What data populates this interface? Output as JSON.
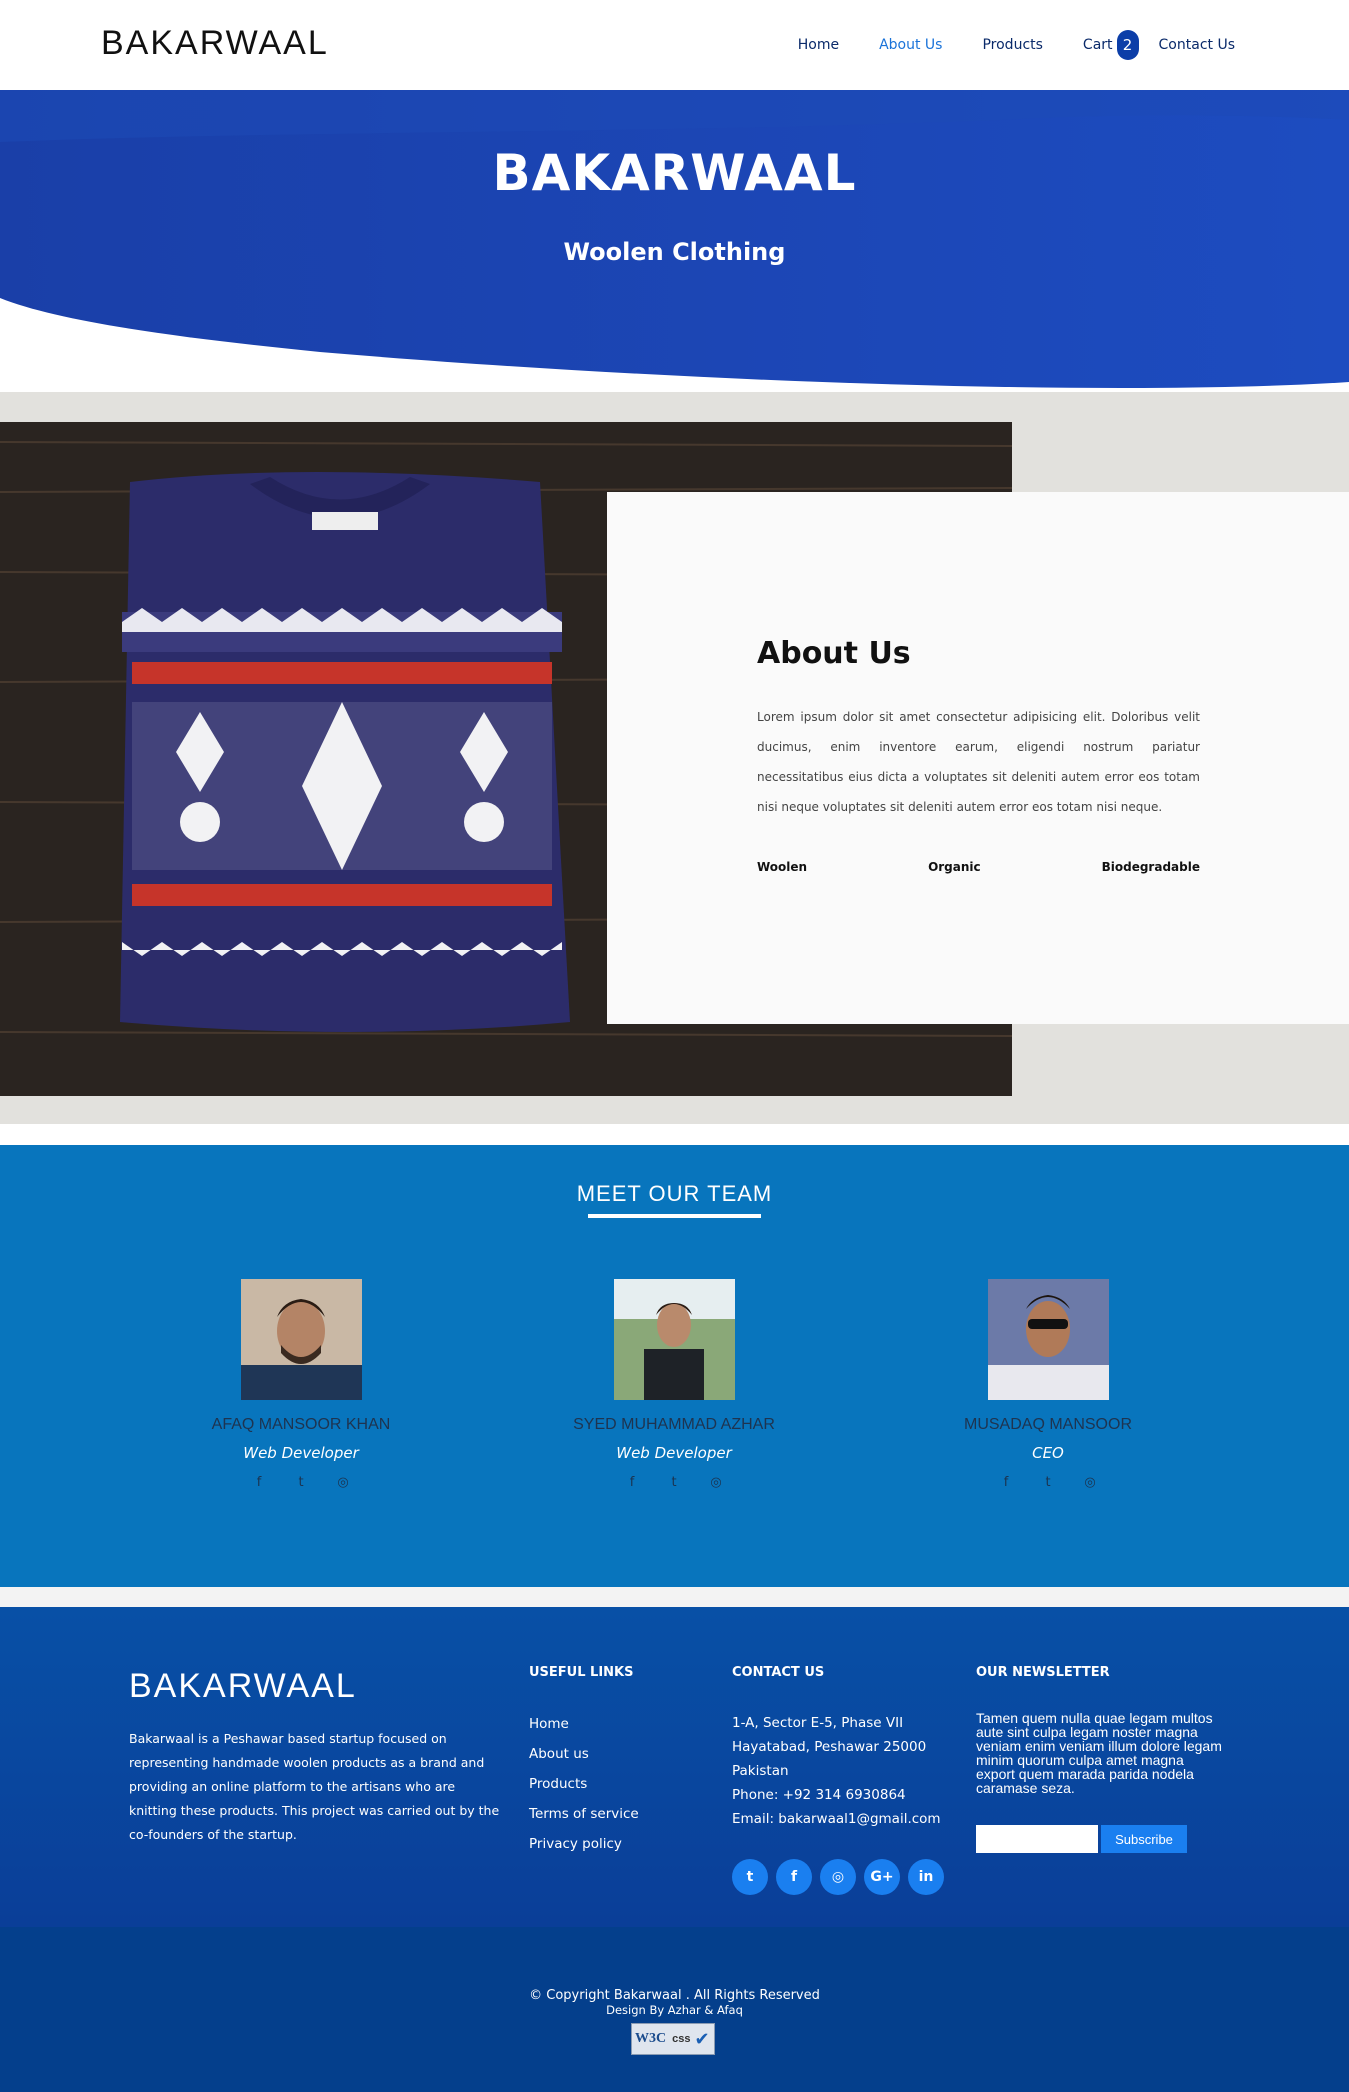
{
  "nav": {
    "logo": "BAKARWAAL",
    "items": [
      {
        "label": "Home",
        "active": false
      },
      {
        "label": "About Us",
        "active": true
      },
      {
        "label": "Products",
        "active": false
      }
    ],
    "cart_label": "Cart",
    "cart_count": "2",
    "contact_label": "Contact Us"
  },
  "hero": {
    "title": "BAKARWAAL",
    "subtitle": "Woolen Clothing",
    "color": "#1a44b0"
  },
  "about": {
    "title": "About Us",
    "text": "Lorem ipsum dolor sit amet consectetur adipisicing elit. Doloribus velit ducimus, enim inventore earum, eligendi nostrum pariatur necessitatibus eius dicta a voluptates sit deleniti autem error eos totam nisi neque voluptates sit deleniti autem error eos totam nisi neque.",
    "features": [
      "Woolen",
      "Organic",
      "Biodegradable"
    ]
  },
  "team": {
    "title": "MEET OUR TEAM",
    "members": [
      {
        "name": "AFAQ MANSOOR KHAN",
        "role": "Web Developer"
      },
      {
        "name": "SYED MUHAMMAD AZHAR",
        "role": "Web Developer"
      },
      {
        "name": "MUSADAQ MANSOOR",
        "role": "CEO"
      }
    ],
    "social_icons": [
      "facebook-icon",
      "twitter-icon",
      "instagram-icon"
    ]
  },
  "footer": {
    "logo": "BAKARWAAL",
    "about": "Bakarwaal is a Peshawar based startup focused on representing handmade woolen products as a brand and providing an online platform to the artisans who are knitting these products. This project was carried out by the co-founders of the startup.",
    "useful_links": {
      "title": "USEFUL LINKS",
      "items": [
        "Home",
        "About us",
        "Products",
        "Terms of service",
        "Privacy policy"
      ]
    },
    "contact": {
      "title": "CONTACT US",
      "line1": "1-A, Sector E-5, Phase VII",
      "line2": "Hayatabad, Peshawar 25000",
      "line3": "Pakistan",
      "phone": "Phone: +92 314 6930864",
      "email": "Email: bakarwaal1@gmail.com"
    },
    "social": [
      {
        "icon": "twitter-icon",
        "glyph": "t"
      },
      {
        "icon": "facebook-icon",
        "glyph": "f"
      },
      {
        "icon": "instagram-icon",
        "glyph": "◎"
      },
      {
        "icon": "google-plus-icon",
        "glyph": "G+"
      },
      {
        "icon": "linkedin-icon",
        "glyph": "in"
      }
    ],
    "newsletter": {
      "title": "OUR NEWSLETTER",
      "text": "Tamen quem nulla quae legam multos aute sint culpa legam noster magna veniam enim veniam illum dolore legam minim quorum culpa amet magna export quem marada parida nodela caramase seza.",
      "input_value": "",
      "button": "Subscribe"
    }
  },
  "bottom": {
    "copyright": "© Copyright Bakarwaal . All Rights Reserved",
    "design": "Design By Azhar & Afaq",
    "badge_w3c": "W3C",
    "badge_css": "css"
  }
}
